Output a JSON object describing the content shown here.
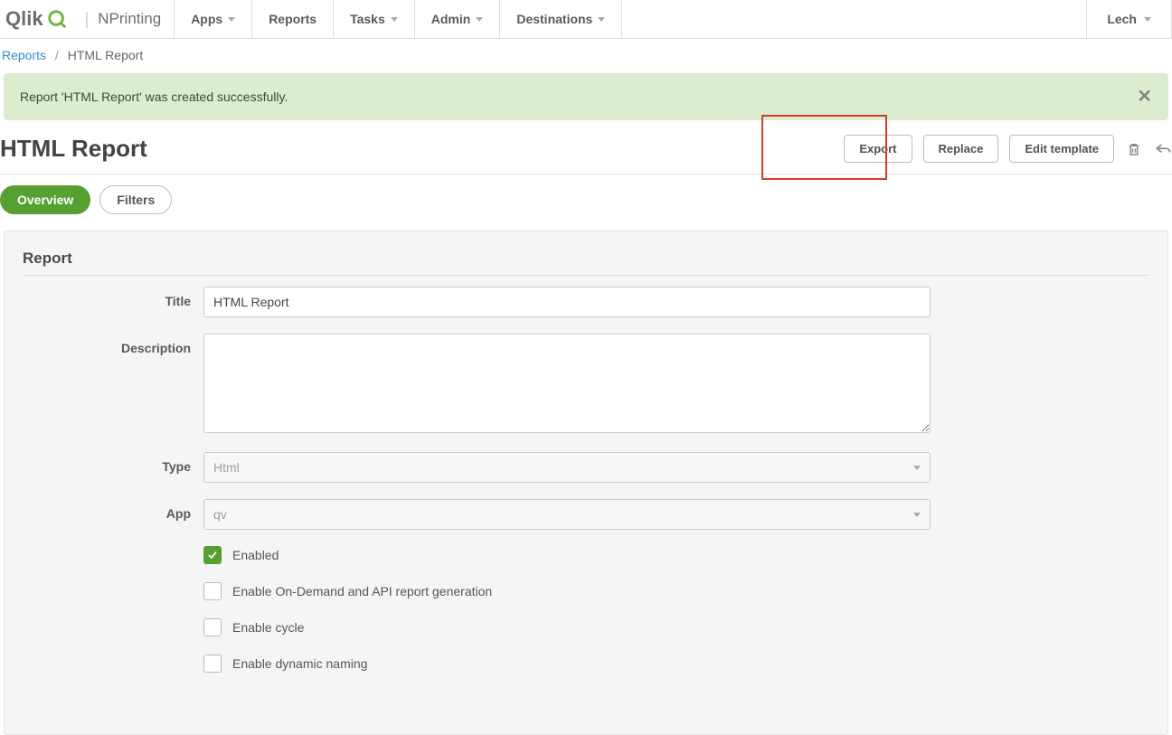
{
  "brand": {
    "qlik": "Qlik",
    "product": "NPrinting"
  },
  "nav": {
    "apps": "Apps",
    "reports": "Reports",
    "tasks": "Tasks",
    "admin": "Admin",
    "destinations": "Destinations"
  },
  "user": {
    "name": "Lech"
  },
  "breadcrumb": {
    "parent": "Reports",
    "current": "HTML Report",
    "sep": "/"
  },
  "alert": {
    "message": "Report 'HTML Report' was created successfully."
  },
  "page": {
    "title": "HTML Report"
  },
  "actions": {
    "export": "Export",
    "replace": "Replace",
    "edit_template": "Edit template"
  },
  "tabs": {
    "overview": "Overview",
    "filters": "Filters"
  },
  "panel": {
    "title": "Report"
  },
  "form": {
    "title_label": "Title",
    "title_value": "HTML Report",
    "description_label": "Description",
    "description_value": "",
    "type_label": "Type",
    "type_value": "Html",
    "app_label": "App",
    "app_value": "qv",
    "enabled_label": "Enabled",
    "ondemand_label": "Enable On-Demand and API report generation",
    "cycle_label": "Enable cycle",
    "dynamic_label": "Enable dynamic naming"
  }
}
